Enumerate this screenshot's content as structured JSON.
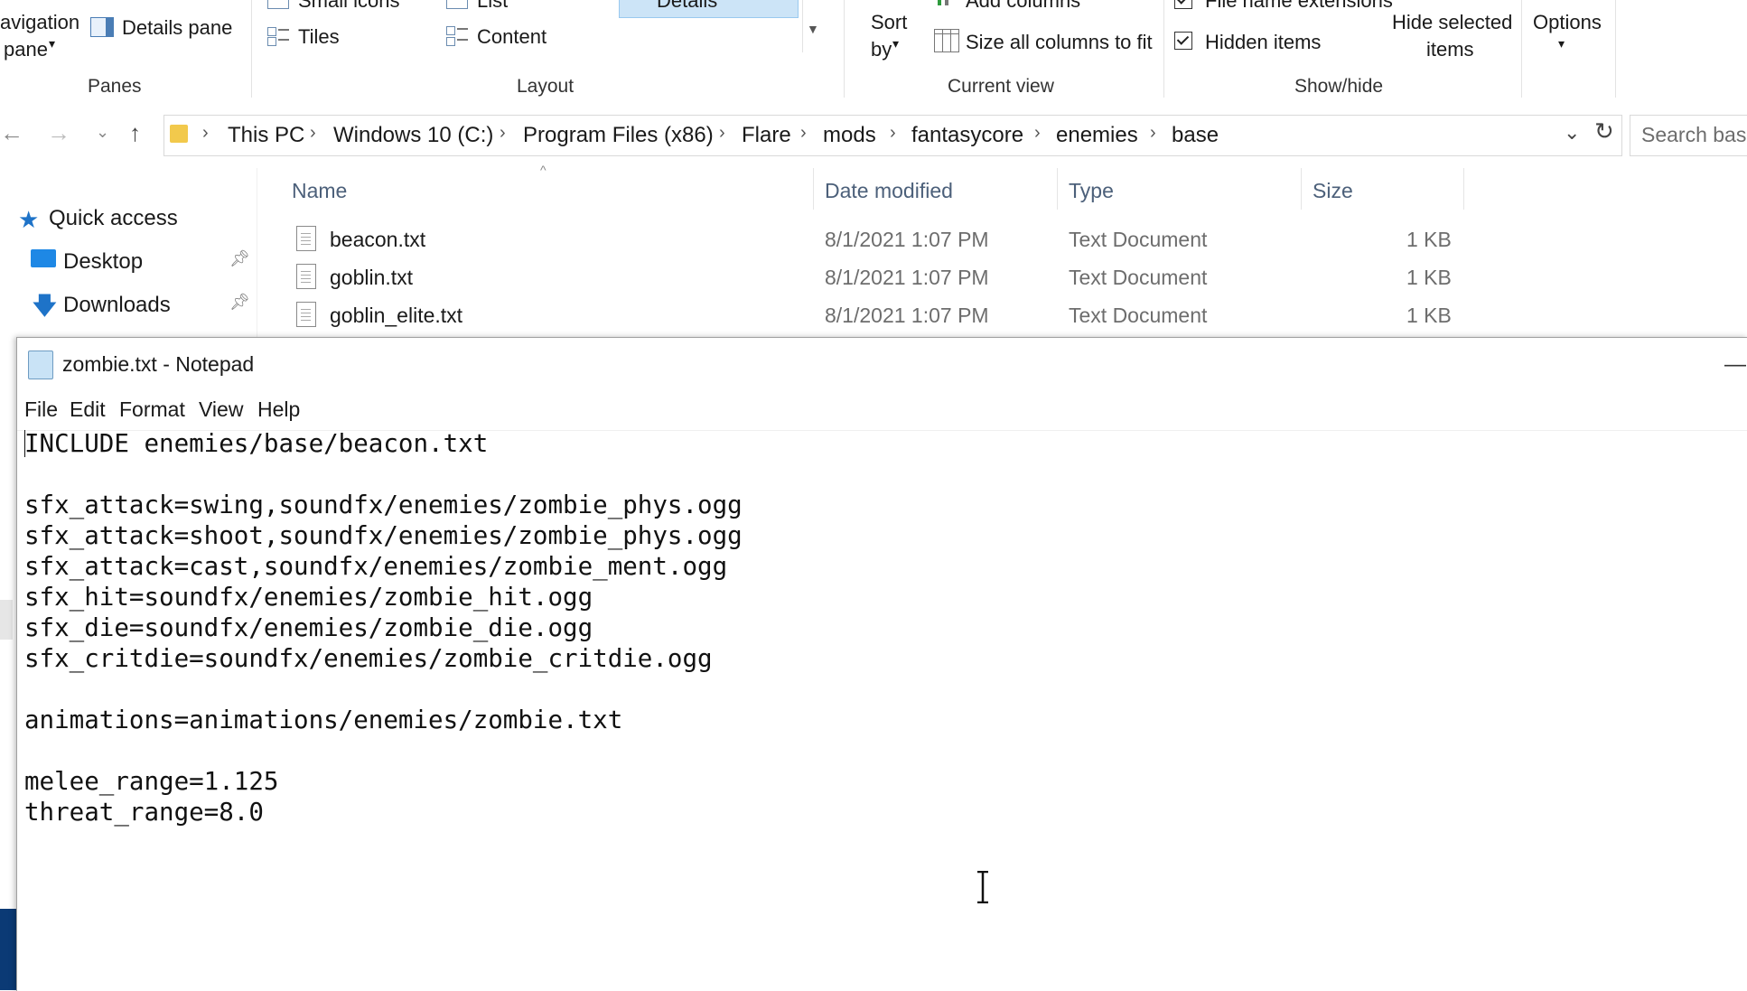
{
  "ribbon": {
    "panes": {
      "nav_pane_line1": "avigation",
      "nav_pane_line2": "pane",
      "details_pane": "Details pane",
      "group": "Panes"
    },
    "layout": {
      "small_icons": "Small icons",
      "list": "List",
      "details": "Details",
      "tiles": "Tiles",
      "content": "Content",
      "group": "Layout"
    },
    "current_view": {
      "sort_line1": "Sort",
      "sort_line2": "by",
      "add_columns": "Add columns",
      "size_all_columns": "Size all columns to fit",
      "group": "Current view"
    },
    "show_hide": {
      "file_name_extensions": "File name extensions",
      "hidden_items": "Hidden items",
      "hide_selected_line1": "Hide selected",
      "hide_selected_line2": "items",
      "group": "Show/hide"
    },
    "options": "Options"
  },
  "address": {
    "crumbs": [
      "This PC",
      "Windows 10 (C:)",
      "Program Files (x86)",
      "Flare",
      "mods",
      "fantasycore",
      "enemies",
      "base"
    ],
    "search_placeholder": "Search base"
  },
  "nav_pane": {
    "quick_access": "Quick access",
    "desktop": "Desktop",
    "downloads": "Downloads"
  },
  "file_list": {
    "columns": [
      "Name",
      "Date modified",
      "Type",
      "Size"
    ],
    "files": [
      {
        "name": "beacon.txt",
        "date": "8/1/2021 1:07 PM",
        "type": "Text Document",
        "size": "1 KB"
      },
      {
        "name": "goblin.txt",
        "date": "8/1/2021 1:07 PM",
        "type": "Text Document",
        "size": "1 KB"
      },
      {
        "name": "goblin_elite.txt",
        "date": "8/1/2021 1:07 PM",
        "type": "Text Document",
        "size": "1 KB"
      }
    ]
  },
  "notepad": {
    "title": "zombie.txt - Notepad",
    "menu": [
      "File",
      "Edit",
      "Format",
      "View",
      "Help"
    ],
    "content": "INCLUDE enemies/base/beacon.txt\n\nsfx_attack=swing,soundfx/enemies/zombie_phys.ogg\nsfx_attack=shoot,soundfx/enemies/zombie_phys.ogg\nsfx_attack=cast,soundfx/enemies/zombie_ment.ogg\nsfx_hit=soundfx/enemies/zombie_hit.ogg\nsfx_die=soundfx/enemies/zombie_die.ogg\nsfx_critdie=soundfx/enemies/zombie_critdie.ogg\n\nanimations=animations/enemies/zombie.txt\n\nmelee_range=1.125\nthreat_range=8.0"
  },
  "colors": {
    "accent_blue": "#0078d7",
    "selection": "#cce4f7",
    "column_header": "#4c607a"
  }
}
